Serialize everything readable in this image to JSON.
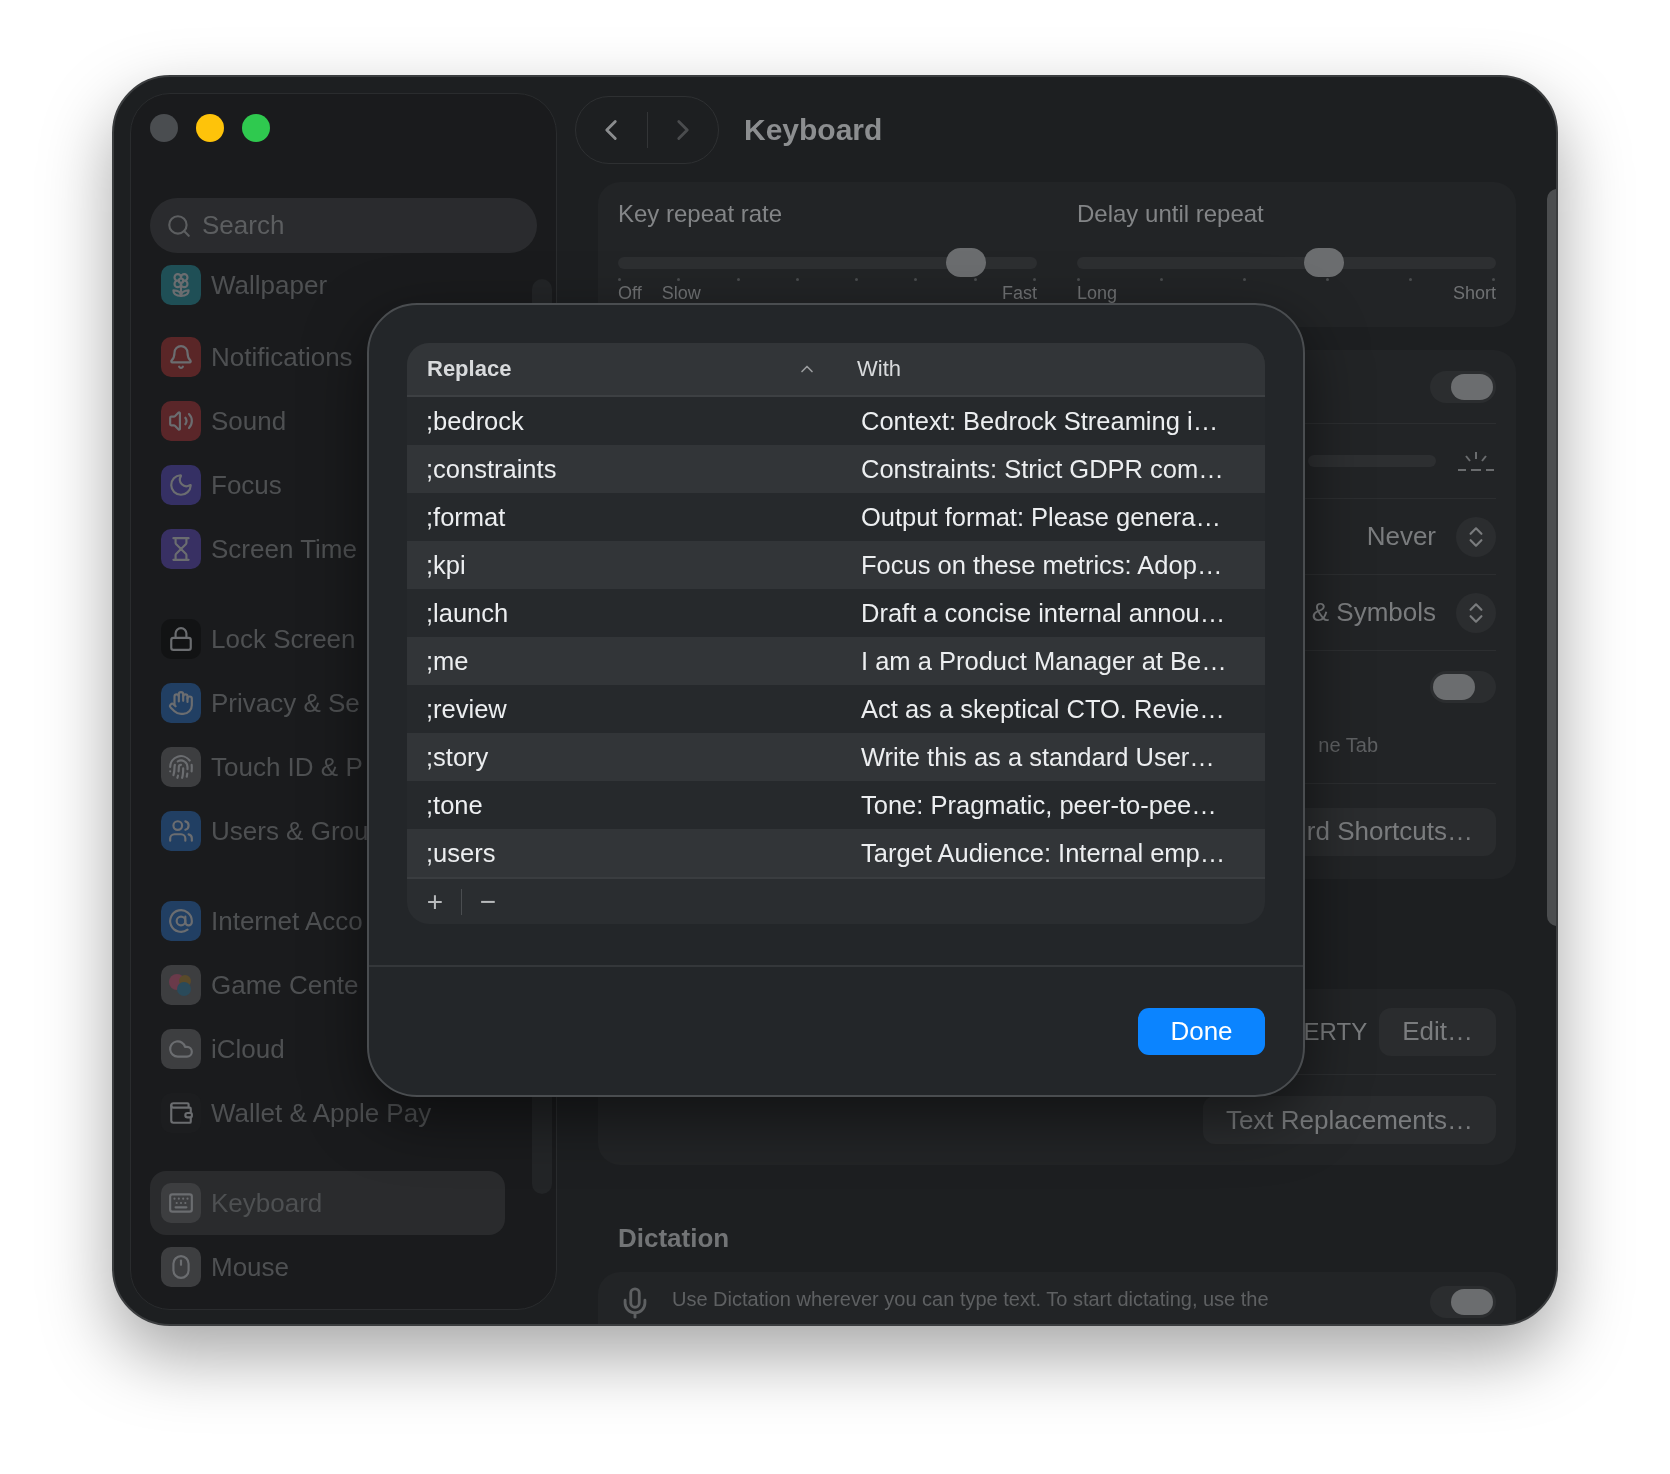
{
  "window_controls": [
    {
      "kind": "close",
      "disabled": true
    },
    {
      "kind": "minimize",
      "disabled": false
    },
    {
      "kind": "zoom",
      "disabled": false
    }
  ],
  "sidebar": {
    "search": {
      "placeholder": "Search"
    },
    "groups": [
      [
        {
          "label": "Wallpaper",
          "selected": false
        }
      ],
      [
        {
          "label": "Notifications",
          "selected": false
        },
        {
          "label": "Sound",
          "selected": false
        },
        {
          "label": "Focus",
          "selected": false
        },
        {
          "label": "Screen Time",
          "selected": false
        }
      ],
      [
        {
          "label": "Lock Screen",
          "selected": false
        },
        {
          "label": "Privacy & Se",
          "selected": false
        },
        {
          "label": "Touch ID & P",
          "selected": false
        },
        {
          "label": "Users & Grou",
          "selected": false
        }
      ],
      [
        {
          "label": "Internet Acco",
          "selected": false
        },
        {
          "label": "Game Cente",
          "selected": false
        },
        {
          "label": "iCloud",
          "selected": false
        },
        {
          "label": "Wallet & Apple Pay",
          "selected": false
        }
      ],
      [
        {
          "label": "Keyboard",
          "selected": true
        },
        {
          "label": "Mouse",
          "selected": false
        }
      ]
    ]
  },
  "toolbar": {
    "title": "Keyboard",
    "back": {
      "disabled": false
    },
    "forward": {
      "disabled": true
    }
  },
  "sliders": [
    {
      "label": "Key repeat rate",
      "level": 0.83,
      "ticks": [
        "Off",
        "Slow",
        "Fast"
      ]
    },
    {
      "label": "Delay until repeat",
      "level": 0.59,
      "ticks": [
        "Long",
        "Short"
      ]
    }
  ],
  "settings": [
    {
      "kind": "toggle",
      "on": true
    },
    {
      "kind": "brightness"
    },
    {
      "kind": "popup",
      "value": "Never"
    },
    {
      "kind": "popup",
      "value": "& Symbols"
    },
    {
      "kind": "toggle",
      "on": false,
      "caption": "ne Tab"
    },
    {
      "kind": "button",
      "label": "rd Shortcuts…"
    }
  ],
  "input_sources": [
    {
      "kind": "button",
      "caption": "ERTY",
      "label": "Edit…"
    },
    {
      "kind": "button",
      "label": "Text Replacements…"
    }
  ],
  "dictation": {
    "heading": "Dictation",
    "description": "Use Dictation wherever you can type text. To start dictating, use the",
    "on": true
  },
  "dialog": {
    "columns": [
      {
        "label": "Replace",
        "sorted": true
      },
      {
        "label": "With",
        "sorted": false
      }
    ],
    "rows": [
      {
        "replace": ";bedrock",
        "with": "Context: Bedrock Streaming i…"
      },
      {
        "replace": ";constraints",
        "with": "Constraints: Strict GDPR com…"
      },
      {
        "replace": ";format",
        "with": "Output format: Please genera…"
      },
      {
        "replace": ";kpi",
        "with": "Focus on these metrics: Adop…"
      },
      {
        "replace": ";launch",
        "with": "Draft a concise internal annou…"
      },
      {
        "replace": ";me",
        "with": "I am a Product Manager at Be…"
      },
      {
        "replace": ";review",
        "with": "Act as a skeptical CTO. Revie…"
      },
      {
        "replace": ";story",
        "with": "Write this as a standard User…"
      },
      {
        "replace": ";tone",
        "with": "Tone: Pragmatic, peer-to-pee…"
      },
      {
        "replace": ";users",
        "with": "Target Audience: Internal emp…"
      }
    ],
    "add": "+",
    "remove": "−",
    "done": "Done"
  }
}
